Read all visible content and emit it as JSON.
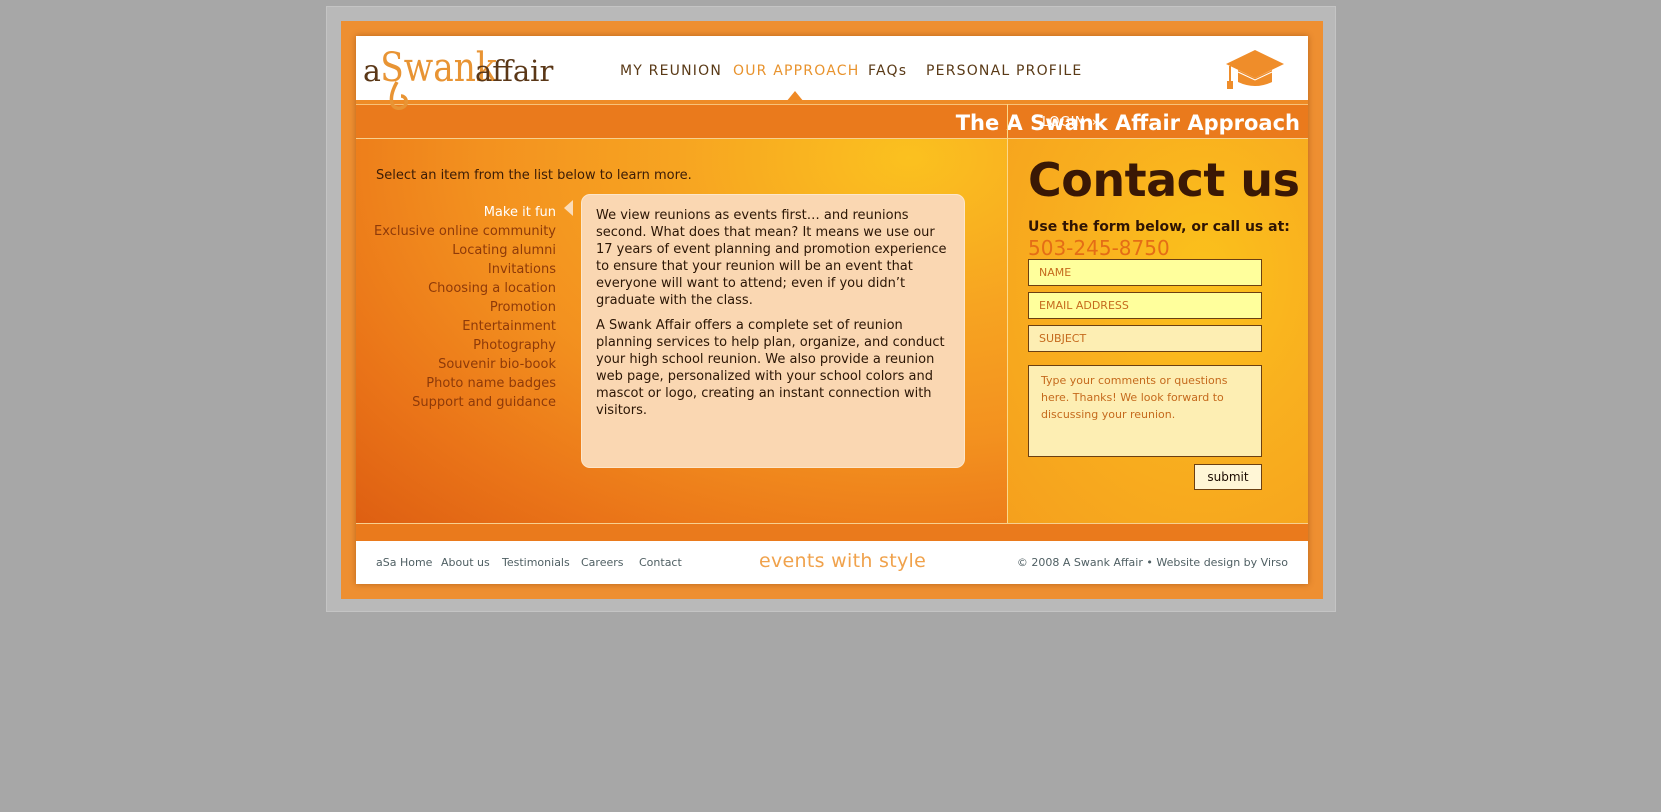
{
  "brand": {
    "logo_a": "a",
    "logo_swank": "Swank",
    "logo_affair": "affair",
    "colors": {
      "orange": "#ea7a1c",
      "gold": "#fbc11b",
      "brown": "#3a1805"
    }
  },
  "nav": {
    "items": [
      {
        "label": "MY REUNION"
      },
      {
        "label": "OUR APPROACH",
        "active": true
      },
      {
        "label": "FAQs"
      },
      {
        "label": "PERSONAL PROFILE"
      }
    ],
    "icon": "graduation-cap-icon"
  },
  "titlebar": {
    "title": "The A Swank Affair Approach",
    "login_label": "LOGIN",
    "login_arrow": "»"
  },
  "main": {
    "intro": "Select an item from the list below to learn more.",
    "topics": [
      "Make it fun",
      "Exclusive online community",
      "Locating alumni",
      "Invitations",
      "Choosing a location",
      "Promotion",
      "Entertainment",
      "Photography",
      "Souvenir bio-book",
      "Photo name badges",
      "Support and guidance"
    ],
    "paragraphs": [
      "We view reunions as events first… and reunions second. What does that mean? It means we use our 17 years of event planning and promotion experience to ensure that your reunion will be an event that everyone will want to attend; even if you didn’t graduate with the class.",
      "A Swank Affair offers a complete set of reunion planning services to help plan, organize, and conduct your high school reunion. We also provide a reunion web page, personalized with your school colors and mascot or logo, creating an instant connection with visitors."
    ]
  },
  "contact": {
    "title": "Contact us",
    "subtitle": "Use the form below, or call us at:",
    "phone": "503-245-8750",
    "name_placeholder": "NAME",
    "email_placeholder": "EMAIL ADDRESS",
    "subject_placeholder": "SUBJECT",
    "comments_placeholder": "Type your comments or questions here. Thanks! We look forward to discussing your reunion.",
    "submit_label": "submit"
  },
  "footer": {
    "links": [
      "aSa Home",
      "About us",
      "Testimonials",
      "Careers",
      "Contact"
    ],
    "tagline": "events with style",
    "copyright": "© 2008 A Swank Affair • Website design by Virso"
  }
}
